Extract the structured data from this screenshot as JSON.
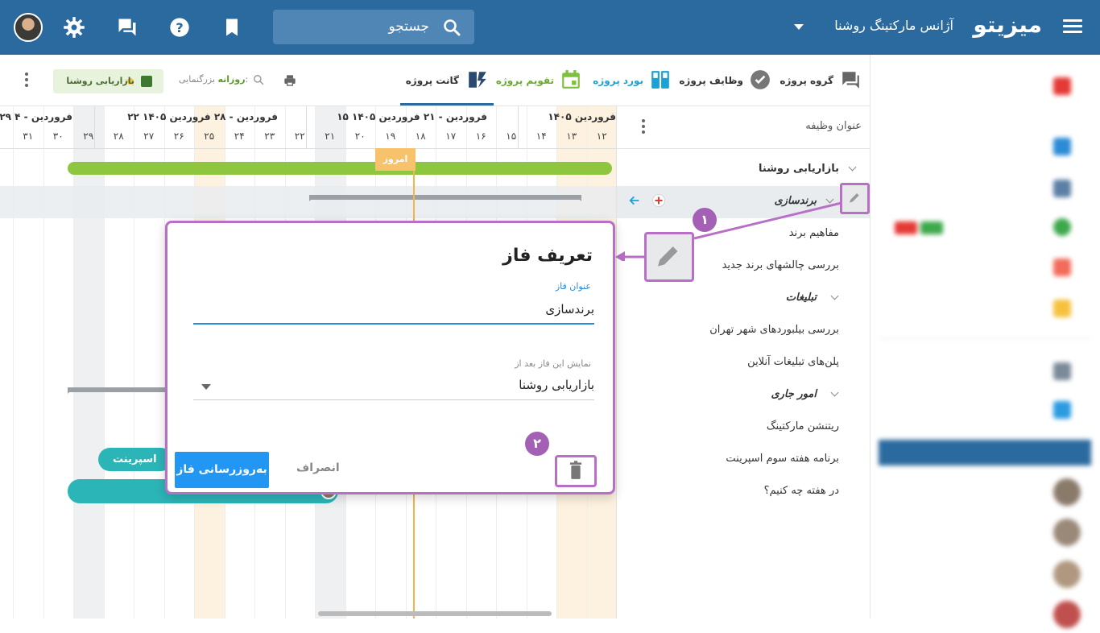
{
  "topbar": {
    "brand": "میزیتو",
    "org": "آژانس مارکتینگ روشنا",
    "search_label": "جستجو"
  },
  "toolbar": {
    "tabs": [
      {
        "label": "گروه پروژه",
        "color": "#333333"
      },
      {
        "label": "وظایف پروژه",
        "color": "#333333"
      },
      {
        "label": "بورد پروژه",
        "color": "#1aa1d6"
      },
      {
        "label": "تقویم پروژه",
        "color": "#6aaa2e"
      },
      {
        "label": "گانت پروژه",
        "color": "#333333"
      }
    ],
    "zoom_prefix": "بزرگنمایی:",
    "zoom_value": "روزانه",
    "filter_chip": "بازاریابی روشنا"
  },
  "gantt": {
    "weeks": [
      "فروردین ۱۴۰۵",
      "۱۵ فروردین - ۲۱ فروردین ۱۴۰۵",
      "۲۲ فروردین - ۲۸ فروردین ۱۴۰۵",
      "۲۹ فروردین - ۴"
    ],
    "days": [
      "۱۲",
      "۱۳",
      "۱۴",
      "۱۵",
      "۱۶",
      "۱۷",
      "۱۸",
      "۱۹",
      "۲۰",
      "۲۱",
      "۲۲",
      "۲۳",
      "۲۴",
      "۲۵",
      "۲۶",
      "۲۷",
      "۲۸",
      "۲۹",
      "۳۰",
      "۳۱"
    ],
    "today_label": "امروز",
    "pill_label": "اسپرینت"
  },
  "tasklist": {
    "header": "عنوان وظیفه",
    "items": [
      {
        "label": "بازاریابی روشنا",
        "kind": "group"
      },
      {
        "label": "برندسازی",
        "kind": "phase"
      },
      {
        "label": "مفاهیم برند",
        "kind": "task"
      },
      {
        "label": "بررسی چالشهای برند جدید",
        "kind": "task"
      },
      {
        "label": "تبلیغات",
        "kind": "phase"
      },
      {
        "label": "بررسی بیلبوردهای شهر تهران",
        "kind": "task"
      },
      {
        "label": "پلن‌های تبلیغات آنلاین",
        "kind": "task"
      },
      {
        "label": "امور جاری",
        "kind": "phase"
      },
      {
        "label": "ریتنشن مارکتینگ",
        "kind": "task"
      },
      {
        "label": "برنامه هفته سوم اسپرینت",
        "kind": "task"
      },
      {
        "label": "در هفته چه کنیم؟",
        "kind": "task"
      }
    ]
  },
  "dialog": {
    "title": "تعریف فاز",
    "field_label": "عنوان فاز",
    "field_value": "برندسازی",
    "select_label": "نمایش این فاز بعد از",
    "select_value": "بازاریابی روشنا",
    "submit": "به‌روزرسانی فاز",
    "cancel": "انصراف"
  },
  "callouts": [
    "۱",
    "۲"
  ],
  "colors": {
    "header": "#2b6a9e",
    "highlight": "#b86fc6",
    "primary": "#2196f3",
    "green_bar": "#8ec63f",
    "teal": "#2bb5b7",
    "today": "#f3b44a"
  }
}
